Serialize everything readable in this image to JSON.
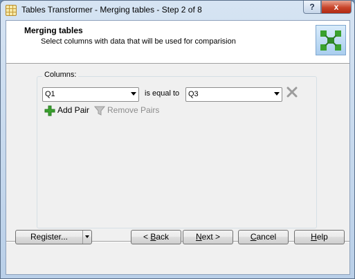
{
  "window": {
    "title": "Tables Transformer - Merging tables - Step 2 of 8",
    "help_label": "?",
    "close_label": "x"
  },
  "header": {
    "title": "Merging tables",
    "subtitle": "Select columns with data that will be used for comparision",
    "logo_icon": "merge-tables-logo-icon"
  },
  "columns": {
    "label": "Columns:",
    "pairs": [
      {
        "left_value": "Q1",
        "operator_label": "is equal to",
        "right_value": "Q3"
      }
    ],
    "add_pair_label": "Add Pair",
    "remove_pairs_label": "Remove Pairs"
  },
  "buttons": {
    "register": {
      "text": "Register..."
    },
    "back": {
      "prefix": "< ",
      "accel": "B",
      "rest": "ack"
    },
    "next": {
      "accel": "N",
      "rest": "ext >"
    },
    "cancel": {
      "accel": "C",
      "rest": "ancel"
    },
    "help": {
      "accel": "H",
      "rest": "elp"
    }
  },
  "colors": {
    "accent_green": "#3aa12e",
    "close_red": "#c8442a",
    "disabled_text": "#8c8c8c"
  }
}
